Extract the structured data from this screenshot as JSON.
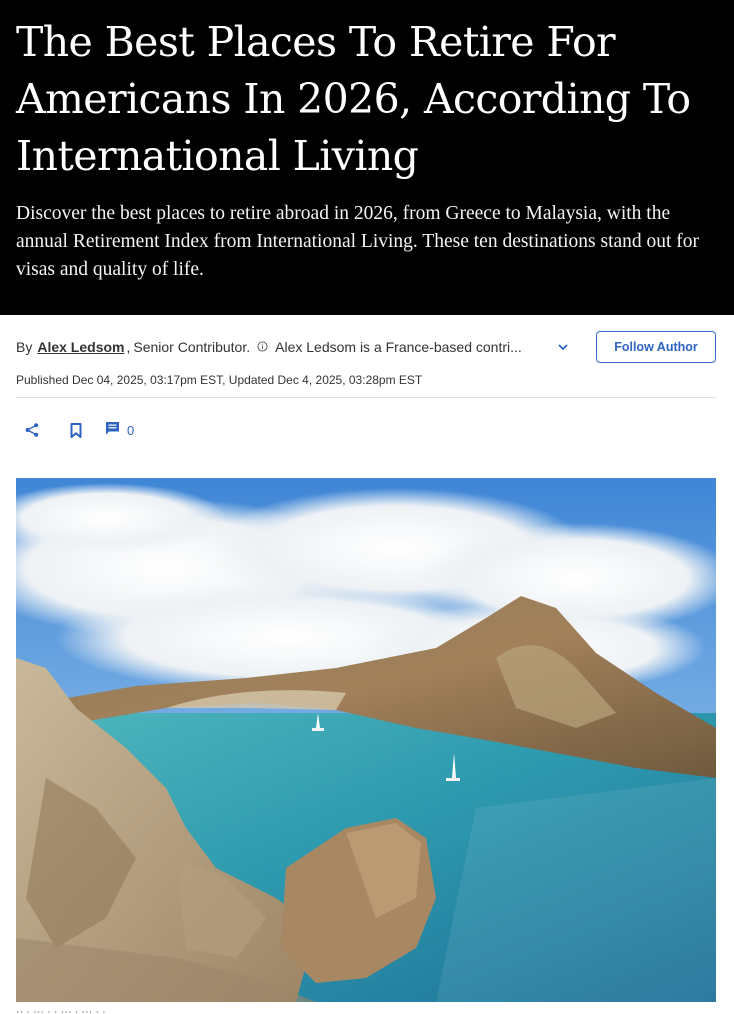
{
  "article": {
    "headline": "The Best Places To Retire For Americans In 2026, According To International Living",
    "dek": "Discover the best places to retire abroad in 2026, from Greece to Malaysia, with the annual Retirement Index from International Living. These ten destinations stand out for visas and quality of life."
  },
  "byline": {
    "by_label": "By",
    "author_name": "Alex Ledsom",
    "author_title": "Senior Contributor.",
    "author_bio": "Alex Ledsom is a France-based contri...",
    "follow_label": "Follow Author"
  },
  "dateline": "Published Dec 04, 2025, 03:17pm EST, Updated Dec 4, 2025, 03:28pm EST",
  "actions": {
    "comment_count": "0",
    "share_icon": "share-icon",
    "bookmark_icon": "bookmark-icon",
    "comment_icon": "comment-icon"
  },
  "colors": {
    "hero_bg": "#000000",
    "accent": "#2f63c2"
  }
}
